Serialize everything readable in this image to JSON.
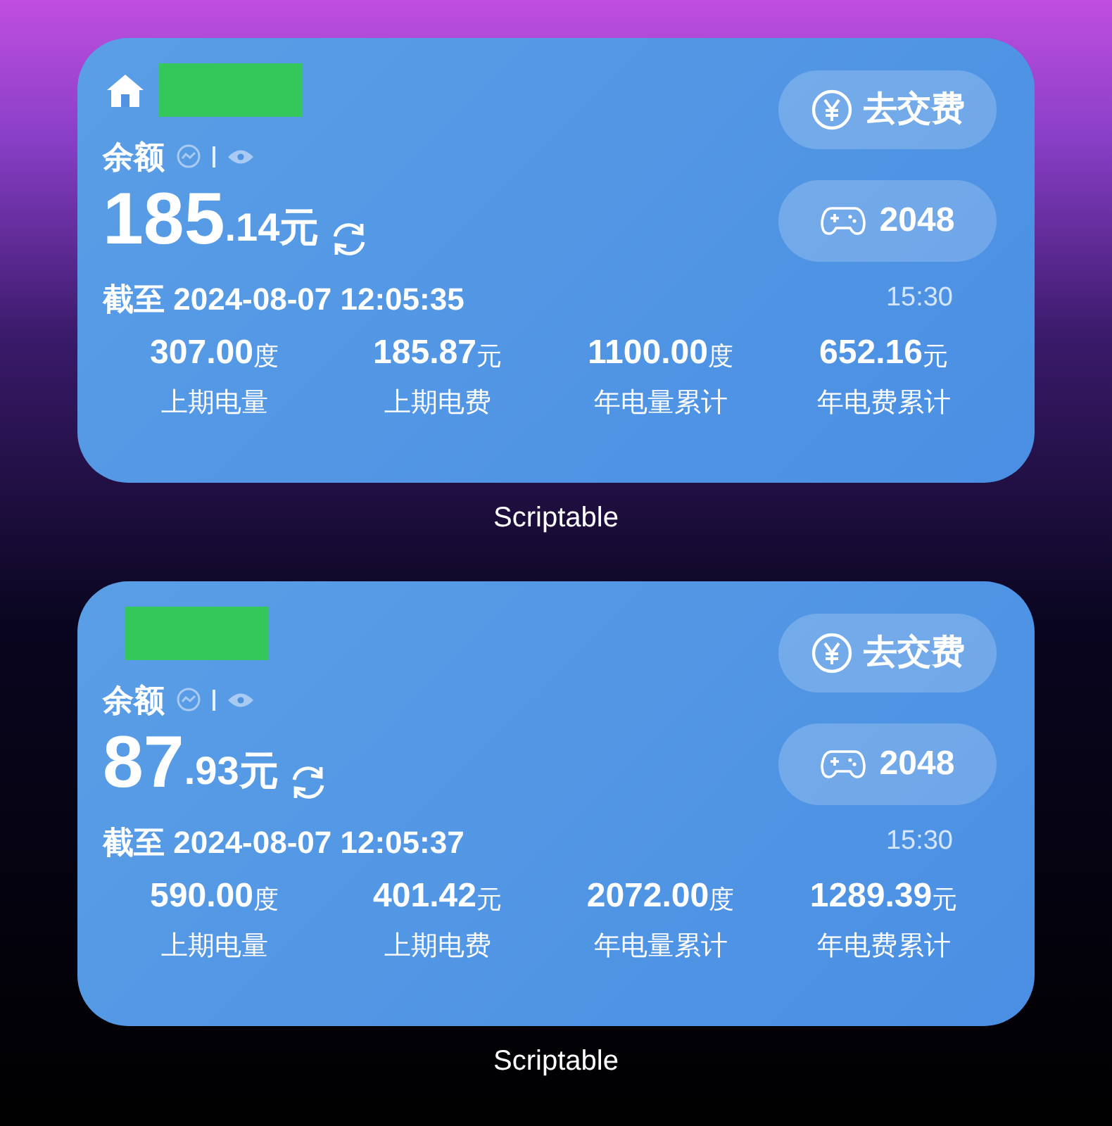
{
  "widgets": [
    {
      "home_icon": true,
      "balance_label": "余额",
      "balance_integer": "185",
      "balance_decimal": ".14",
      "balance_unit": "元",
      "pay_button": "去交费",
      "game_button": "2048",
      "as_of": "截至 2024-08-07 12:05:35",
      "time": "15:30",
      "stats": [
        {
          "value": "307.00",
          "unit": "度",
          "label": "上期电量"
        },
        {
          "value": "185.87",
          "unit": "元",
          "label": "上期电费"
        },
        {
          "value": "1100.00",
          "unit": "度",
          "label": "年电量累计"
        },
        {
          "value": "652.16",
          "unit": "元",
          "label": "年电费累计"
        }
      ],
      "app_name": "Scriptable"
    },
    {
      "home_icon": false,
      "balance_label": "余额",
      "balance_integer": "87",
      "balance_decimal": ".93",
      "balance_unit": "元",
      "pay_button": "去交费",
      "game_button": "2048",
      "as_of": "截至 2024-08-07 12:05:37",
      "time": "15:30",
      "stats": [
        {
          "value": "590.00",
          "unit": "度",
          "label": "上期电量"
        },
        {
          "value": "401.42",
          "unit": "元",
          "label": "上期电费"
        },
        {
          "value": "2072.00",
          "unit": "度",
          "label": "年电量累计"
        },
        {
          "value": "1289.39",
          "unit": "元",
          "label": "年电费累计"
        }
      ],
      "app_name": "Scriptable"
    }
  ]
}
